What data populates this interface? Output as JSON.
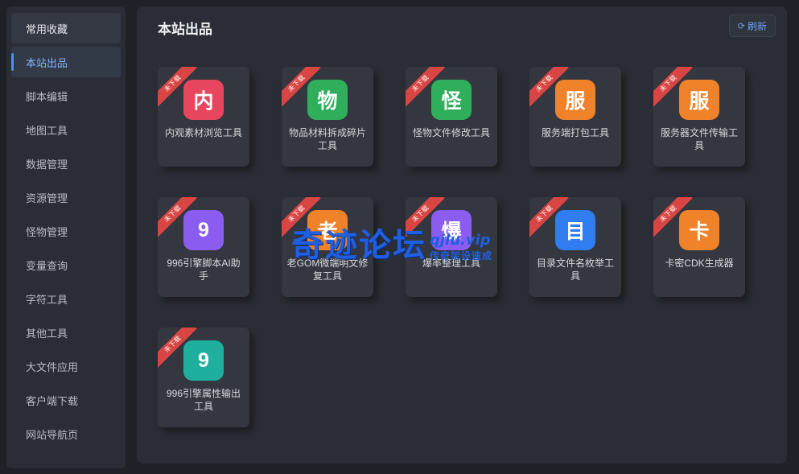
{
  "sidebar": {
    "items": [
      {
        "label": "常用收藏",
        "state": "favorite"
      },
      {
        "label": "本站出品",
        "state": "active"
      },
      {
        "label": "脚本编辑",
        "state": ""
      },
      {
        "label": "地图工具",
        "state": ""
      },
      {
        "label": "数据管理",
        "state": ""
      },
      {
        "label": "资源管理",
        "state": ""
      },
      {
        "label": "怪物管理",
        "state": ""
      },
      {
        "label": "变量查询",
        "state": ""
      },
      {
        "label": "字符工具",
        "state": ""
      },
      {
        "label": "其他工具",
        "state": ""
      },
      {
        "label": "大文件应用",
        "state": ""
      },
      {
        "label": "客户端下载",
        "state": ""
      },
      {
        "label": "网站导航页",
        "state": ""
      }
    ]
  },
  "main": {
    "title": "本站出品",
    "refresh_label": "刷新",
    "refresh_icon": "refresh-icon"
  },
  "ribbon_label": "未下载",
  "tools": [
    {
      "glyph": "内",
      "name": "内观素材浏览工具",
      "color": "#e8465f"
    },
    {
      "glyph": "物",
      "name": "物品材料拆成碎片工具",
      "color": "#2fae5c"
    },
    {
      "glyph": "怪",
      "name": "怪物文件修改工具",
      "color": "#2fae5c"
    },
    {
      "glyph": "服",
      "name": "服务端打包工具",
      "color": "#f0822a"
    },
    {
      "glyph": "服",
      "name": "服务器文件传输工具",
      "color": "#f0822a"
    },
    {
      "glyph": "9",
      "name": "996引擎脚本AI助手",
      "color": "#8a5cf0"
    },
    {
      "glyph": "老",
      "name": "老GOM微端明文修复工具",
      "color": "#f0822a"
    },
    {
      "glyph": "爆",
      "name": "爆率整理工具",
      "color": "#8a5cf0"
    },
    {
      "glyph": "目",
      "name": "目录文件名枚举工具",
      "color": "#2f7df0"
    },
    {
      "glyph": "卡",
      "name": "卡密CDK生成器",
      "color": "#f0822a"
    },
    {
      "glyph": "9",
      "name": "996引擎属性输出工具",
      "color": "#1faf9e"
    }
  ],
  "watermark": {
    "main": "奇迹论坛",
    "url": "qjlu.vip",
    "sub": "传奇架设速成"
  }
}
